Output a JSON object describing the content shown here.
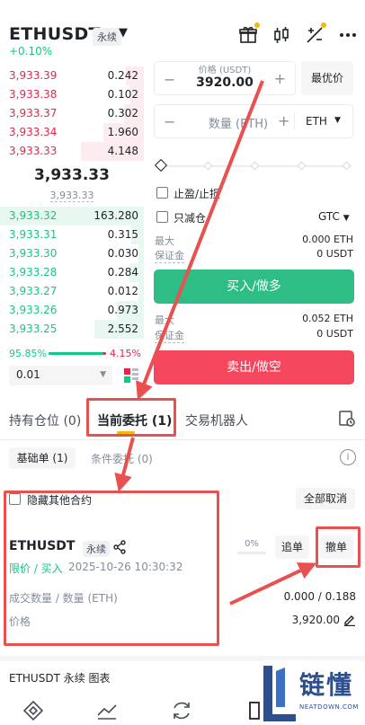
{
  "header": {
    "symbol": "ETHUSDT",
    "contract_type": "永续",
    "change": "+0.10%"
  },
  "orderbook": {
    "asks": [
      {
        "price": "3,933.39",
        "qty": "0.242"
      },
      {
        "price": "3,933.38",
        "qty": "0.102"
      },
      {
        "price": "3,933.37",
        "qty": "0.302"
      },
      {
        "price": "3,933.34",
        "qty": "1.960"
      },
      {
        "price": "3,933.33",
        "qty": "4.148"
      }
    ],
    "last_price": "3,933.33",
    "mark_price": "3,933.33",
    "bids": [
      {
        "price": "3,933.32",
        "qty": "163.280"
      },
      {
        "price": "3,933.31",
        "qty": "0.315"
      },
      {
        "price": "3,933.30",
        "qty": "0.030"
      },
      {
        "price": "3,933.28",
        "qty": "0.284"
      },
      {
        "price": "3,933.27",
        "qty": "0.012"
      },
      {
        "price": "3,933.26",
        "qty": "0.973"
      },
      {
        "price": "3,933.25",
        "qty": "2.552"
      }
    ],
    "buy_ratio": "95.85%",
    "sell_ratio": "4.15%",
    "buy_fraction": 0.9585,
    "precision": "0.01"
  },
  "form": {
    "price_label": "价格 (USDT)",
    "price_value": "3920.00",
    "bbo_button": "最优价",
    "qty_placeholder": "数量 (ETH)",
    "qty_unit": "ETH",
    "tpsl_label": "止盈/止损",
    "reduce_only_label": "只减仓",
    "tif": "GTC",
    "buy_max_label": "最大",
    "buy_max_value": "0.000 ETH",
    "buy_margin_label": "保证金",
    "buy_margin_value": "0 USDT",
    "buy_button": "买入/做多",
    "sell_max_label": "最大",
    "sell_max_value": "0.052 ETH",
    "sell_margin_label": "保证金",
    "sell_margin_value": "0 USDT",
    "sell_button": "卖出/做空"
  },
  "tabs": {
    "positions": "持有仓位 (0)",
    "open_orders": "当前委托 (1)",
    "bots": "交易机器人"
  },
  "subtabs": {
    "basic": "基础单 (1)",
    "conditional": "条件委托 (0)"
  },
  "filters": {
    "hide_other": "隐藏其他合约",
    "cancel_all": "全部取消"
  },
  "order": {
    "symbol": "ETHUSDT",
    "contract_type": "永续",
    "fill_pct": "0%",
    "chase_button": "追单",
    "cancel_button": "撤单",
    "type": "限价 / 买入",
    "time": "2025-10-26 10:30:32",
    "filled_label": "成交数量 / 数量 (ETH)",
    "filled_value": "0.000 / 0.188",
    "price_label": "价格",
    "price_value": "3,920.00"
  },
  "footer": {
    "chart_title": "ETHUSDT 永续  图表"
  },
  "watermark": {
    "brand": "链懂",
    "domain": "NEATDOWN.COM"
  },
  "colors": {
    "green": "#0ecb81",
    "red": "#e0294a",
    "annotation": "#e8514f"
  }
}
